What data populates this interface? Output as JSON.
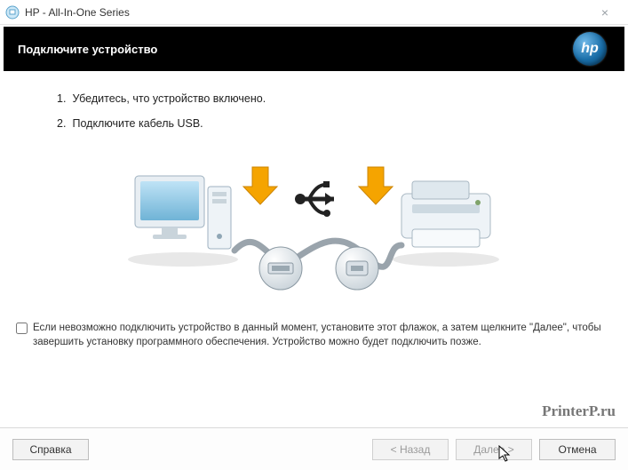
{
  "window": {
    "title": "HP - All-In-One Series",
    "close_glyph": "×"
  },
  "banner": {
    "title": "Подключите устройство",
    "logo_text": "hp"
  },
  "instructions": {
    "items": [
      {
        "num": "1.",
        "text": "Убедитесь, что устройство включено."
      },
      {
        "num": "2.",
        "text": "Подключите кабель USB."
      }
    ]
  },
  "checkbox": {
    "label": "Если невозможно подключить устройство в данный момент, установите этот флажок, а затем щелкните \"Далее\", чтобы завершить установку программного обеспечения. Устройство можно будет подключить позже.",
    "checked": false
  },
  "footer": {
    "help": "Справка",
    "back": "< Назад",
    "next": "Далее >",
    "cancel": "Отмена",
    "back_disabled": true,
    "next_disabled": true
  },
  "watermark": "PrinterP.ru",
  "illustration": {
    "alt": "computer-usb-printer-diagram"
  }
}
